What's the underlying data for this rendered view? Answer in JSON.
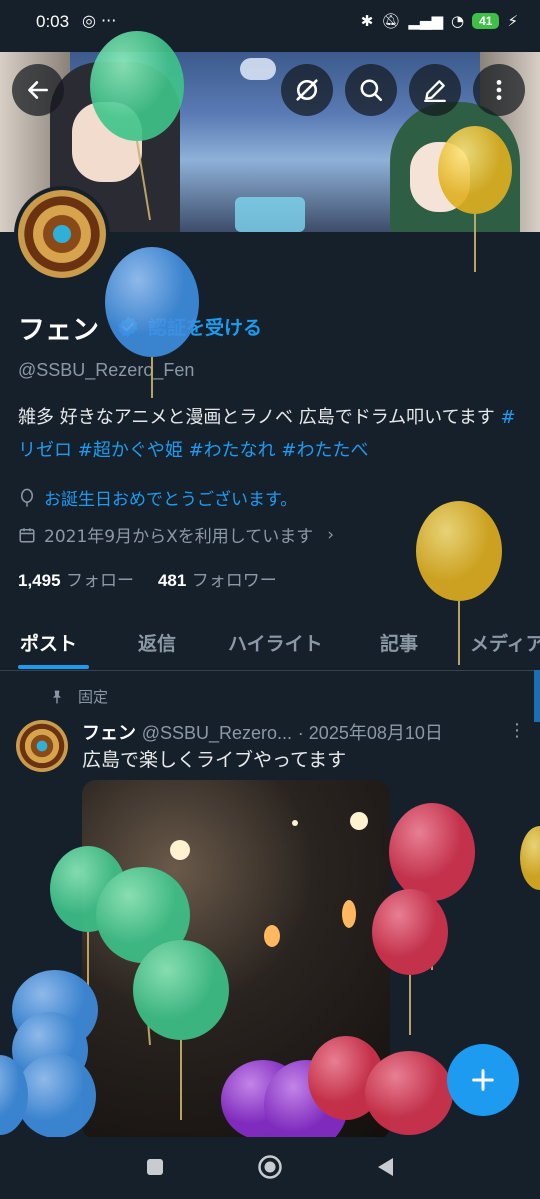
{
  "status_bar": {
    "time": "0:03",
    "left_icons": "◎ ···",
    "battery": "41"
  },
  "profile": {
    "name": "フェン",
    "verify_cta": "認証を受ける",
    "handle": "@SSBU_Rezero_Fen",
    "bio_text": "雑多 好きなアニメと漫画とラノベ 広島でドラム叩いてます",
    "bio_tags": [
      "#リゼロ",
      "#超かぐや姫",
      "#わたなれ",
      "#わたたべ"
    ],
    "birthday_text": "お誕生日おめでとうございます。",
    "joined_text": "2021年9月からXを利用しています",
    "following_count": "1,495",
    "following_label": "フォロー",
    "followers_count": "481",
    "followers_label": "フォロワー"
  },
  "tabs": [
    {
      "label": "ポスト",
      "active": true
    },
    {
      "label": "返信",
      "active": false
    },
    {
      "label": "ハイライト",
      "active": false
    },
    {
      "label": "記事",
      "active": false
    },
    {
      "label": "メディア",
      "active": false
    }
  ],
  "pinned_post": {
    "pinned_label": "固定",
    "author_name": "フェン",
    "author_handle": "@SSBU_Rezero...",
    "date": "· 2025年08月10日",
    "text": "広島で楽しくライブやってます"
  },
  "icons": {
    "back": "back-arrow-icon",
    "grok": "grok-icon",
    "search": "search-icon",
    "edit": "edit-icon",
    "more": "more-vertical-icon",
    "compose": "plus-icon"
  },
  "colors": {
    "background": "#15202b",
    "accent": "#1d9bf0",
    "muted": "#8b98a5"
  }
}
